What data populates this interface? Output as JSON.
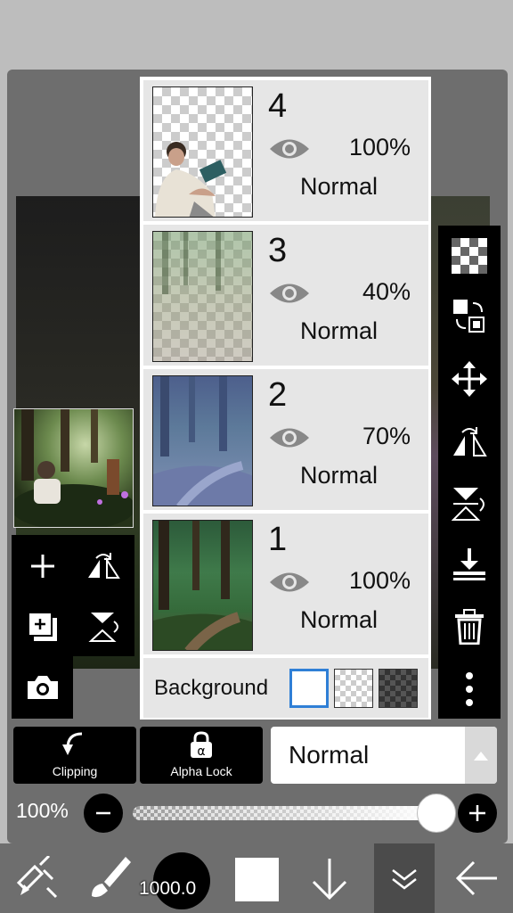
{
  "layers": [
    {
      "number": "4",
      "opacity": "100%",
      "mode": "Normal",
      "visible": true
    },
    {
      "number": "3",
      "opacity": "40%",
      "mode": "Normal",
      "visible": true
    },
    {
      "number": "2",
      "opacity": "70%",
      "mode": "Normal",
      "visible": true
    },
    {
      "number": "1",
      "opacity": "100%",
      "mode": "Normal",
      "visible": true
    }
  ],
  "background": {
    "label": "Background",
    "options": [
      "white",
      "transparent",
      "dark-checker"
    ],
    "selected": "white"
  },
  "buttons": {
    "clipping": "Clipping",
    "alpha_lock": "Alpha Lock"
  },
  "blend_mode": {
    "value": "Normal"
  },
  "opacity": {
    "label": "100%",
    "value": 1.0
  },
  "brush": {
    "size": "1000.0"
  },
  "colors": {
    "accent": "#2f7fd6",
    "panel": "#6e6e6e",
    "toolbar": "#000000",
    "current_color": "#ffffff"
  }
}
